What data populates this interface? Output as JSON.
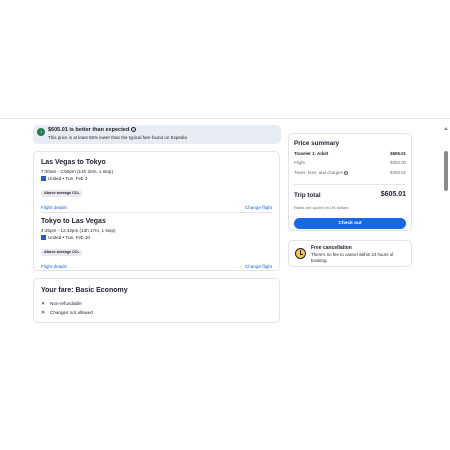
{
  "banner": {
    "icon": "check-down-icon",
    "title": "$605.01 is better than expected",
    "info_glyph": "i",
    "subtitle": "This price is at least 55% lower than the typical fare found on Expedia"
  },
  "flights": [
    {
      "route": "Las Vegas to Tokyo",
      "times": "7:30am - 2:50pm (14h 20m, 1 stop)",
      "airline_date": "United • Tue, Feb 3",
      "co2_badge": "Above average CO₂",
      "details_link": "Flight details",
      "change_link": "Change flight"
    },
    {
      "route": "Tokyo to Las Vegas",
      "times": "4:25pm - 12:42pm (13h 17m, 1 stop)",
      "airline_date": "United • Tue, Feb 10",
      "co2_badge": "Above average CO₂",
      "details_link": "Flight details",
      "change_link": "Change flight"
    }
  ],
  "fare": {
    "title": "Your fare: Basic Economy",
    "rules": [
      "Non-refundable",
      "Changes not allowed"
    ],
    "rule_icon": "x-icon"
  },
  "summary": {
    "title": "Price summary",
    "traveler_label": "Traveler 1: Adult",
    "traveler_value": "$605.01",
    "flight_label": "Flight",
    "flight_value": "$300.00",
    "taxes_label": "Taxes, fees, and charges",
    "taxes_value": "$305.01",
    "total_label": "Trip total",
    "total_value": "$605.01",
    "currency_note": "Rates are quoted in US dollars",
    "checkout_label": "Check out"
  },
  "cancellation": {
    "icon": "clock-check-icon",
    "title": "Free cancellation",
    "subtitle": "There's no fee to cancel within 24 hours of booking."
  },
  "colors": {
    "accent": "#1668e3",
    "success": "#227950",
    "banner_bg": "#e8edf3"
  }
}
